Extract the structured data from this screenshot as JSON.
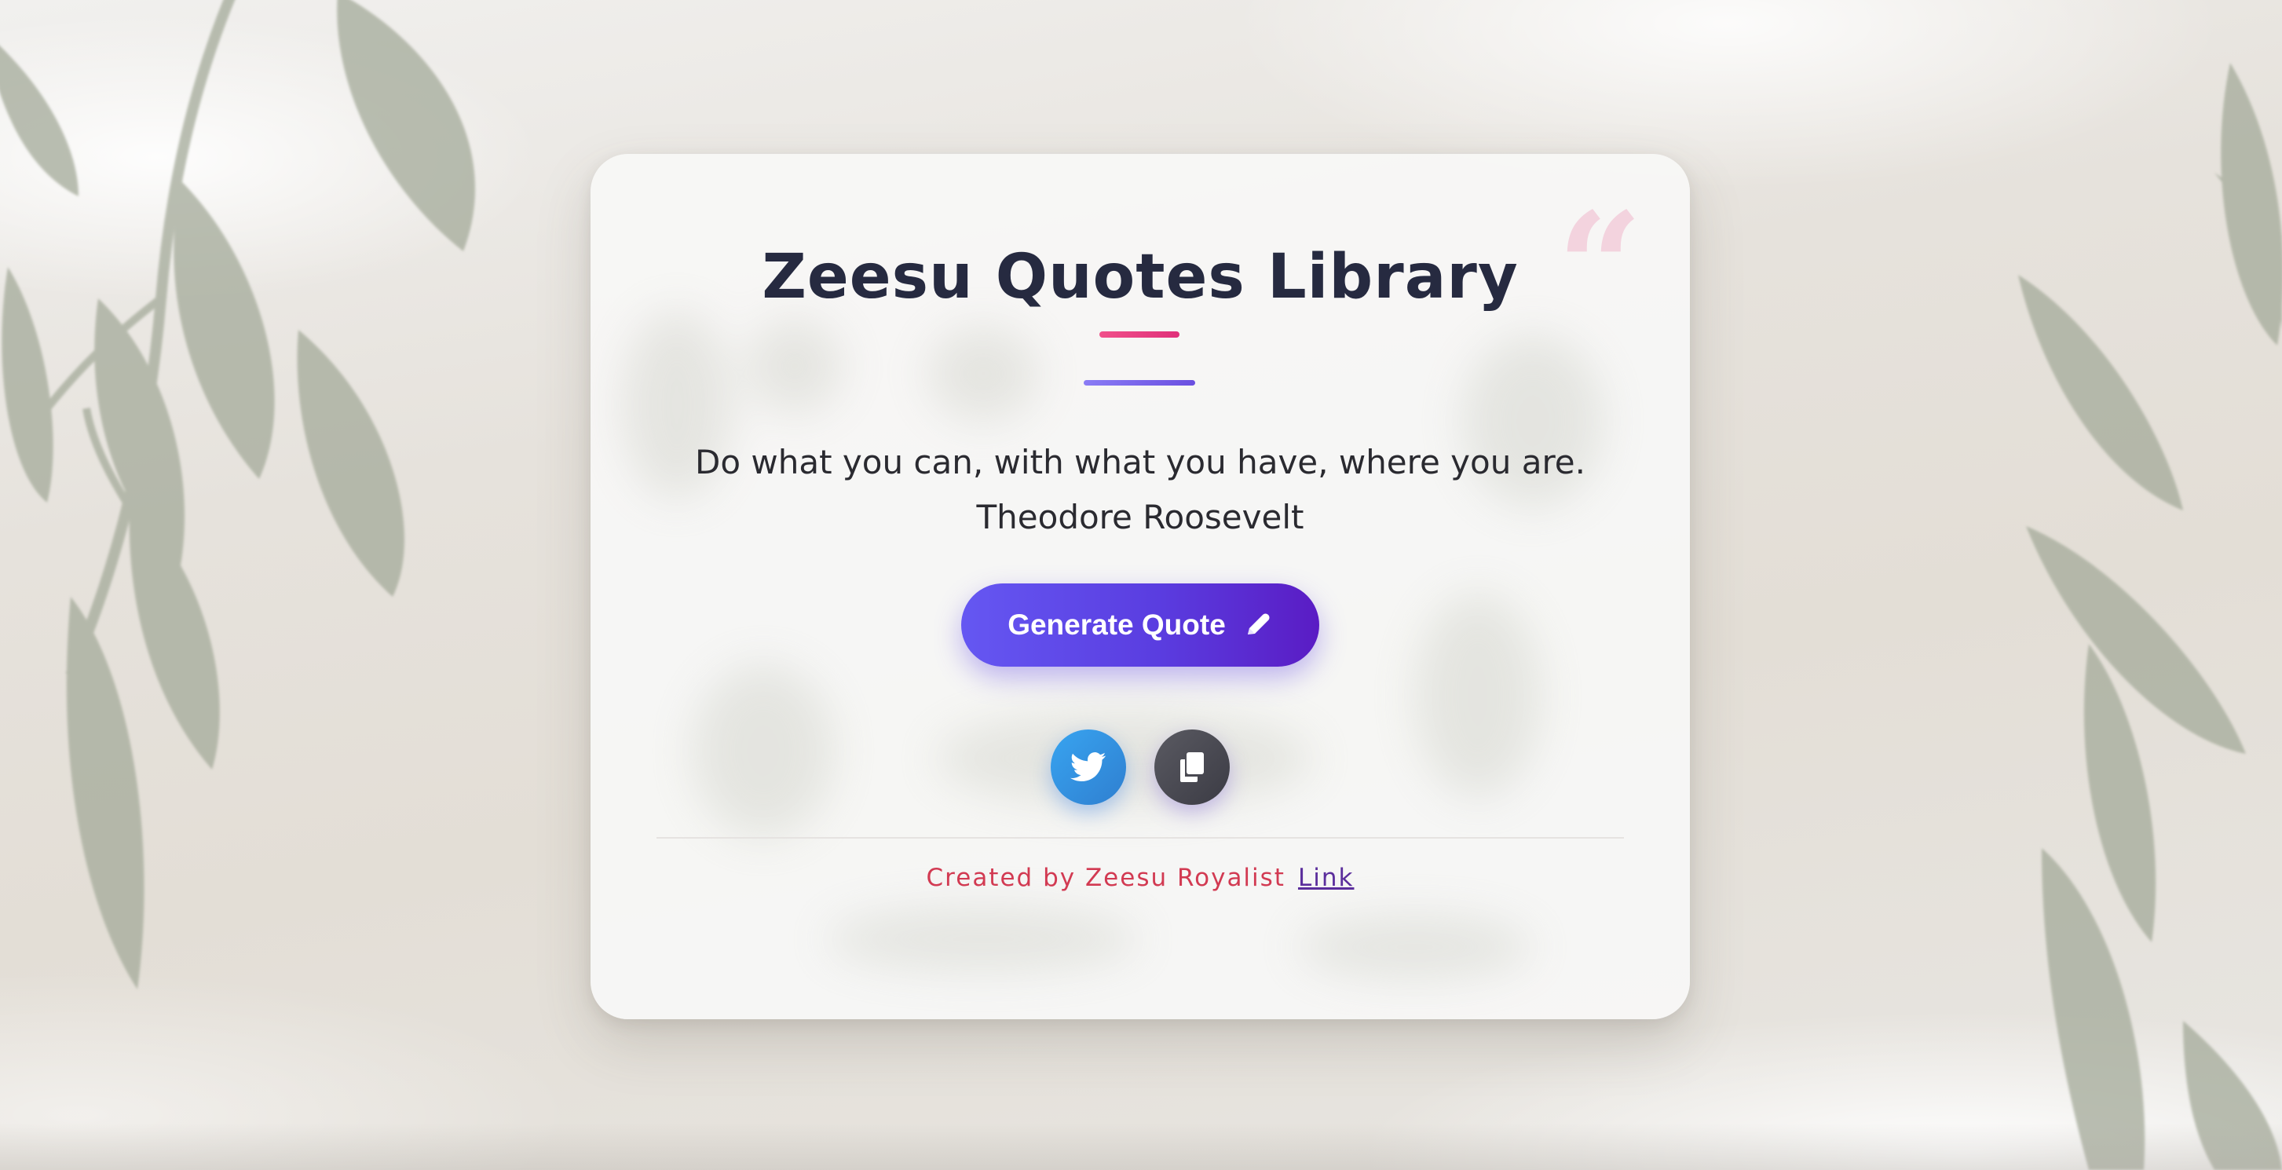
{
  "header": {
    "title": "Zeesu Quotes Library"
  },
  "quote": {
    "text": "Do what you can, with what you have, where you are.",
    "author": "Theodore Roosevelt"
  },
  "actions": {
    "generate_label": "Generate Quote",
    "generate_icon": "pencil-icon",
    "twitter_icon": "twitter-icon",
    "copy_icon": "copy-icon"
  },
  "footer": {
    "credit": "Created by Zeesu Royalist",
    "link_label": "Link"
  },
  "colors": {
    "title": "#262a40",
    "accent_pink": "#e0307a",
    "accent_purple": "#6a4fe0",
    "button_gradient_start": "#6557f2",
    "button_gradient_end": "#5a1cc4",
    "twitter_blue": "#2f7fd0",
    "copy_gray": "#3b3b44",
    "credit_red": "#d23a52",
    "link_purple": "#5b2e9c",
    "quote_mark_pink": "#f3d3de"
  }
}
